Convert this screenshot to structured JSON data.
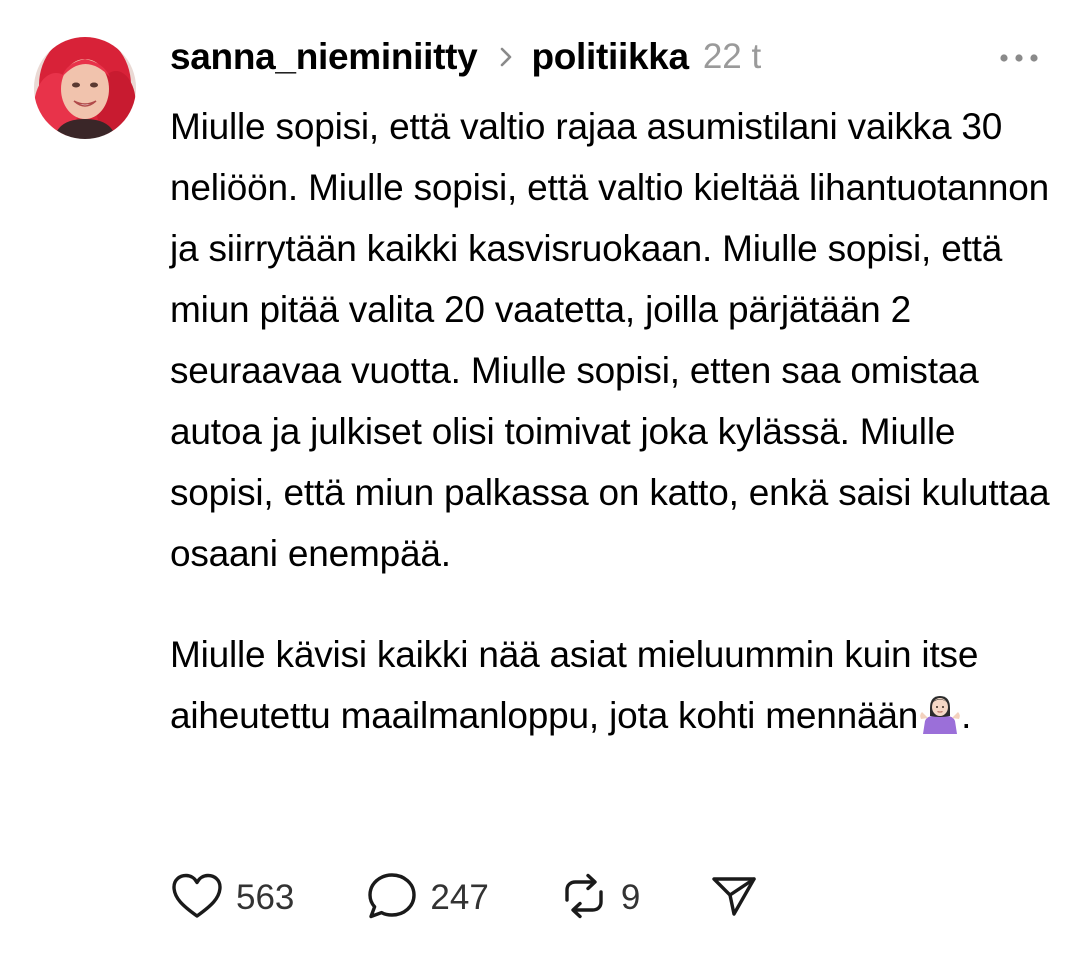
{
  "post": {
    "author": "sanna_nieminiitty",
    "topic": "politiikka",
    "timestamp": "22 t",
    "paragraphs": [
      "Miulle sopisi, että valtio rajaa asumistilani vaikka 30 neliöön. Miulle sopisi, että valtio kieltää lihantuotannon ja siirrytään kaikki kasvisruokaan. Miulle sopisi, että miun pitää valita 20 vaatetta, joilla pärjätään 2 seuraavaa vuotta. Miulle sopisi, etten saa omistaa autoa ja julkiset olisi toimivat joka kylässä. Miulle sopisi, että miun palkassa on katto, enkä saisi kuluttaa osaani enempää."
    ],
    "closing_text": "Miulle kävisi kaikki nää asiat mieluummin kuin itse aiheutettu maailmanloppu, jota kohti mennään",
    "closing_emoji": "person-shrugging-emoji",
    "closing_punct": ".",
    "counts": {
      "likes": "563",
      "replies": "247",
      "reposts": "9"
    }
  },
  "icons": {
    "topic_separator": "chevron-right-icon",
    "more": "more-horizontal-icon",
    "like": "heart-icon",
    "reply": "speech-bubble-icon",
    "repost": "repost-icon",
    "share": "send-icon"
  },
  "colors": {
    "text": "#000000",
    "muted": "#9a9a9a",
    "icon": "#1a1a1a",
    "avatar_hair": "#e0283a"
  }
}
